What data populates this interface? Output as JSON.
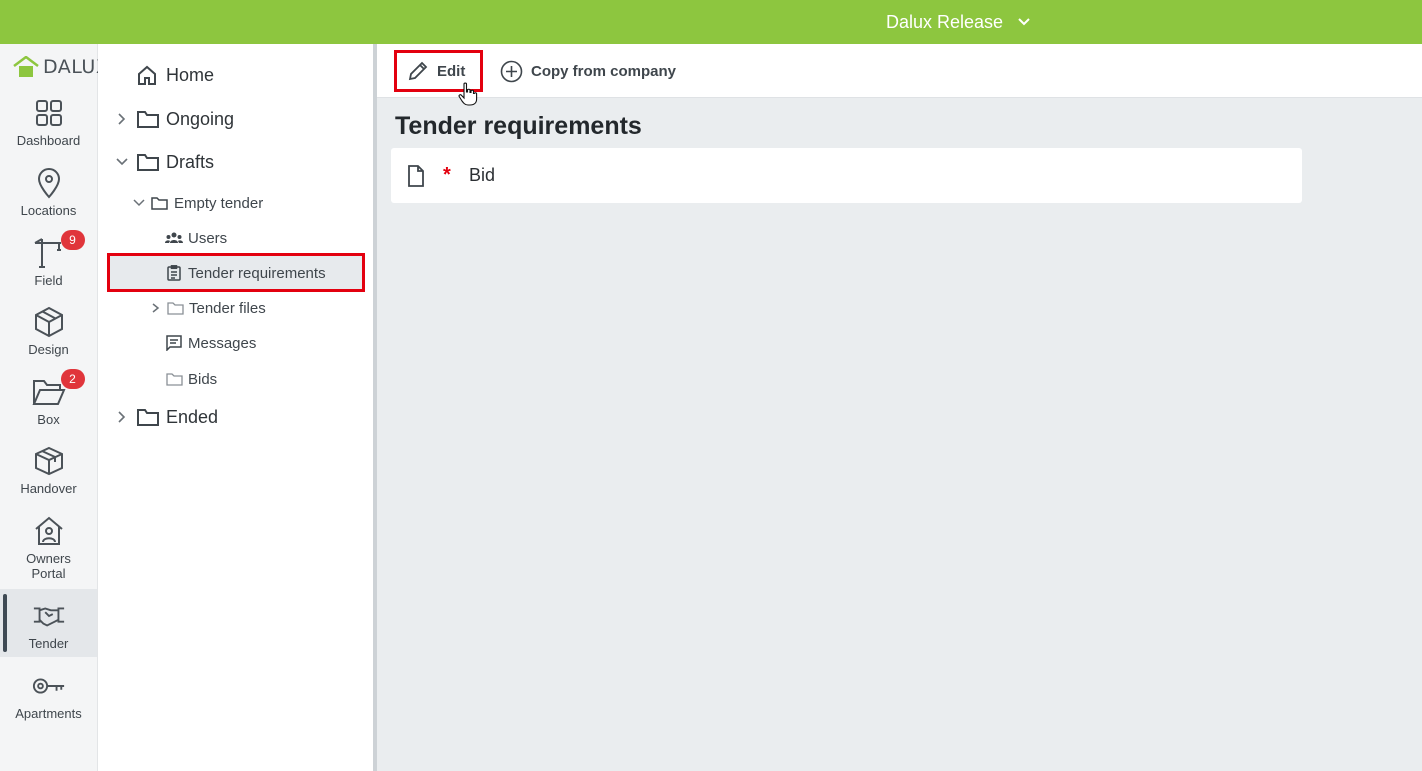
{
  "topbar": {
    "project": "Dalux Release"
  },
  "brand": {
    "logo_text": "DALUX",
    "accent": "#8dc63f"
  },
  "rail": [
    {
      "label": "Dashboard",
      "icon": "dashboard-icon"
    },
    {
      "label": "Locations",
      "icon": "location-pin-icon"
    },
    {
      "label": "Field",
      "icon": "crane-icon",
      "badge": "9"
    },
    {
      "label": "Design",
      "icon": "cube-icon"
    },
    {
      "label": "Box",
      "icon": "folder-open-icon",
      "badge": "2"
    },
    {
      "label": "Handover",
      "icon": "box-icon"
    },
    {
      "label": "Owners Portal",
      "icon": "house-user-icon"
    },
    {
      "label": "Tender",
      "icon": "handshake-icon",
      "active": true
    },
    {
      "label": "Apartments",
      "icon": "key-icon"
    }
  ],
  "tree": {
    "home": "Home",
    "ongoing": "Ongoing",
    "drafts": "Drafts",
    "empty_tender": "Empty tender",
    "users": "Users",
    "tender_requirements": "Tender requirements",
    "tender_files": "Tender files",
    "messages": "Messages",
    "bids": "Bids",
    "ended": "Ended"
  },
  "toolbar": {
    "edit": "Edit",
    "copy": "Copy from company"
  },
  "main": {
    "heading": "Tender requirements",
    "items": [
      {
        "name": "Bid",
        "required_mark": "*"
      }
    ]
  },
  "colors": {
    "highlight": "#e3000f",
    "badge": "#e0353b"
  }
}
